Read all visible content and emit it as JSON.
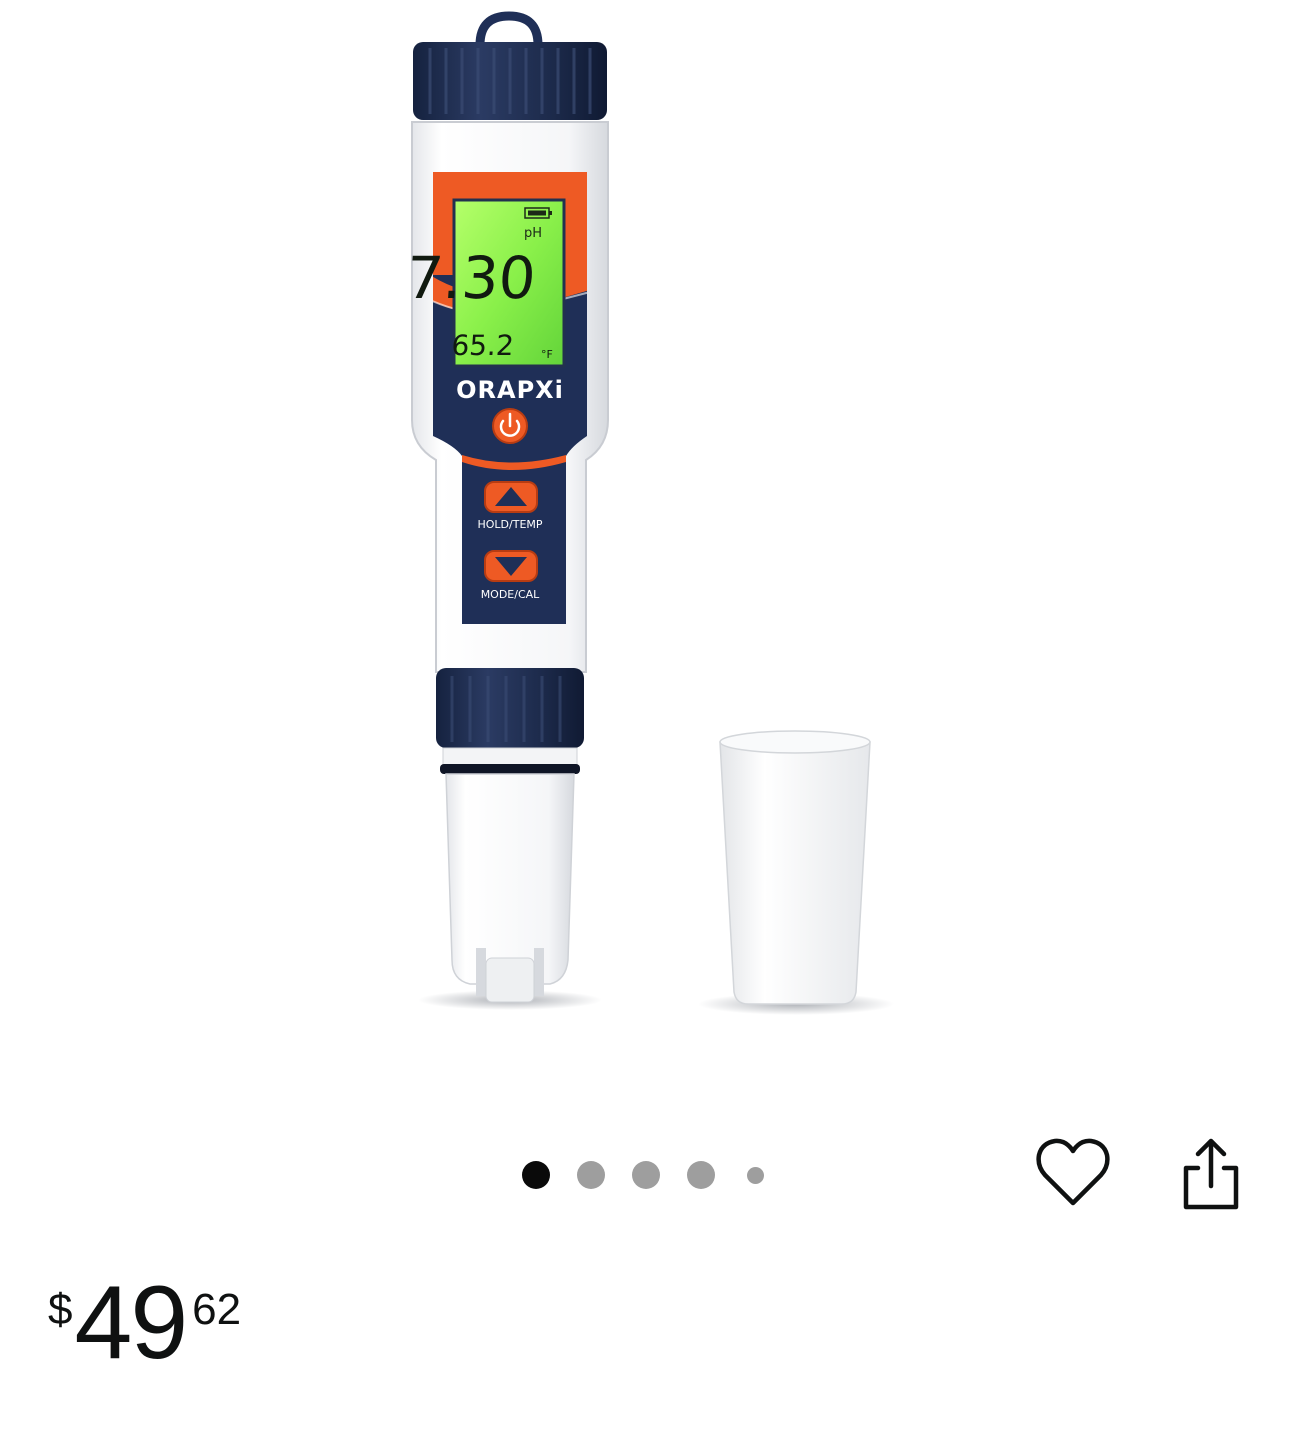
{
  "product": {
    "brand": "ORAPXi",
    "lcd": {
      "unit_label": "pH",
      "primary_reading": "7.30",
      "secondary_reading": "65.2",
      "temp_unit": "°F"
    },
    "buttons": {
      "hold_temp": "HOLD/TEMP",
      "mode_cal": "MODE/CAL"
    }
  },
  "carousel": {
    "total_images": 5,
    "active_index": 0
  },
  "actions": {
    "wishlist_icon": "heart-icon",
    "share_icon": "share-icon"
  },
  "price": {
    "currency_symbol": "$",
    "whole": "49",
    "fraction": "62"
  },
  "colors": {
    "accent_orange": "#ee5a24",
    "navy": "#1f2f57",
    "lcd_green": "#8af04a",
    "dot_active": "#0a0a0a",
    "dot_inactive": "#9e9e9e"
  }
}
